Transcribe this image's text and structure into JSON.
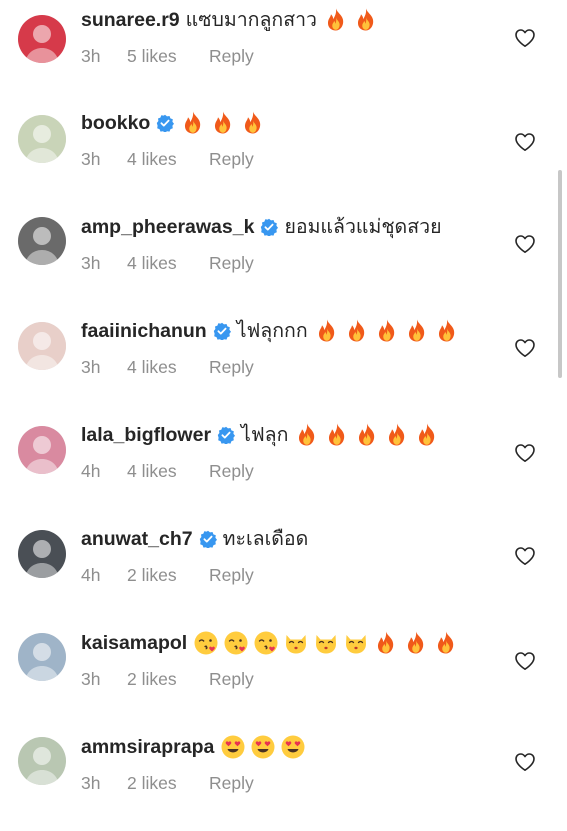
{
  "comments": [
    {
      "username": "sunaree.r9",
      "verified": false,
      "text": "แซบมากลูกสาว",
      "emojis": [
        "fire",
        "fire"
      ],
      "time": "3h",
      "likes": "5 likes",
      "reply": "Reply",
      "avatar_color": "#d63a4a"
    },
    {
      "username": "bookko",
      "verified": true,
      "text": "",
      "emojis": [
        "fire",
        "fire",
        "fire"
      ],
      "time": "3h",
      "likes": "4 likes",
      "reply": "Reply",
      "avatar_color": "#c9d4b8"
    },
    {
      "username": "amp_pheerawas_k",
      "verified": true,
      "text": "ยอมแล้วแม่ชุดสวย",
      "emojis": [],
      "time": "3h",
      "likes": "4 likes",
      "reply": "Reply",
      "avatar_color": "#6a6a6a"
    },
    {
      "username": "faaiinichanun",
      "verified": true,
      "text": "ไฟลุกกก",
      "emojis": [
        "fire",
        "fire",
        "fire",
        "fire",
        "fire"
      ],
      "time": "3h",
      "likes": "4 likes",
      "reply": "Reply",
      "avatar_color": "#e8cfc9"
    },
    {
      "username": "lala_bigflower",
      "verified": true,
      "text": "ไฟลุก",
      "emojis": [
        "fire",
        "fire",
        "fire",
        "fire",
        "fire"
      ],
      "time": "4h",
      "likes": "4 likes",
      "reply": "Reply",
      "avatar_color": "#d98aa0"
    },
    {
      "username": "anuwat_ch7",
      "verified": true,
      "text": "ทะเลเดือด",
      "emojis": [],
      "time": "4h",
      "likes": "2 likes",
      "reply": "Reply",
      "avatar_color": "#4a4f55"
    },
    {
      "username": "kaisamapol",
      "verified": false,
      "text": "",
      "emojis": [
        "kiss",
        "kiss",
        "kiss",
        "cat-kiss",
        "cat-kiss",
        "cat-kiss",
        "fire",
        "fire",
        "fire"
      ],
      "time": "3h",
      "likes": "2 likes",
      "reply": "Reply",
      "avatar_color": "#9fb4c8"
    },
    {
      "username": "ammsiraprapa",
      "verified": false,
      "text": "",
      "emojis": [
        "heart-eyes",
        "heart-eyes",
        "heart-eyes"
      ],
      "time": "3h",
      "likes": "2 likes",
      "reply": "Reply",
      "avatar_color": "#b9c7b2"
    }
  ],
  "colors": {
    "verified": "#3897f0",
    "meta": "#8e8e8e",
    "text": "#262626"
  }
}
